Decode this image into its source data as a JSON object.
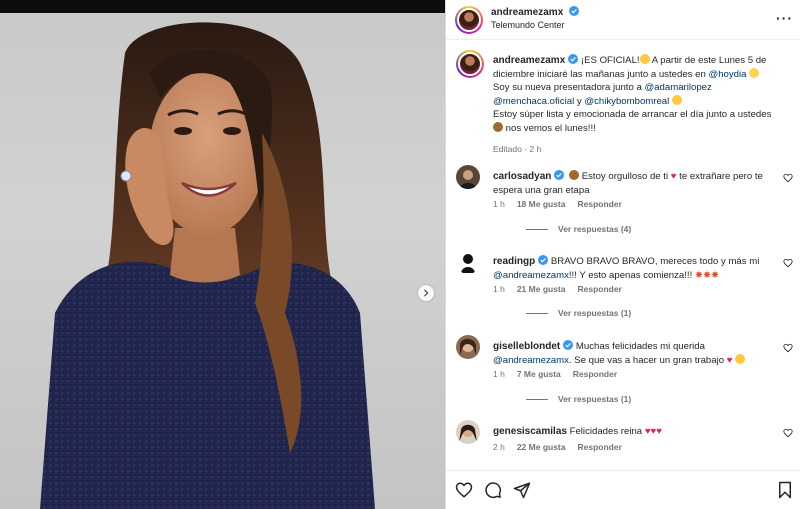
{
  "post": {
    "username": "andreamezamx",
    "location": "Telemundo Center",
    "caption": {
      "username": "andreamezamx",
      "line1_pre": "¡ES OFICIAL!",
      "line1_post": " A partir de este Lunes 5 de diciembre iniciaré las mañanas junto a ustedes en ",
      "hashtag": "@hoydia",
      "line2_pre": "Soy su nueva presentadora junto a ",
      "mention1": "@adamarilopez",
      "mention2": "@menchaca.oficial",
      "and": " y ",
      "mention3": "@chikybombomreal",
      "line3": "Estoy súper lista y emocionada de arrancar el día junto a ustedes",
      "line3_end": " nos vemos el lunes!!!",
      "meta": "Editado · 2 h"
    }
  },
  "comments": [
    {
      "username": "carlosadyan",
      "text_pre": " Estoy orgulloso de ti ",
      "text_post": " te extrañare pero te espera una gran etapa",
      "time": "1 h",
      "likes": "18 Me gusta",
      "reply": "Responder",
      "replies": "Ver respuestas (4)"
    },
    {
      "username": "readingp",
      "text_pre": "BRAVO BRAVO BRAVO, mereces todo y más mi ",
      "mention": "@andreamezamx",
      "text_post": "!!! Y esto apenas comienza!!! ",
      "time": "1 h",
      "likes": "21 Me gusta",
      "reply": "Responder",
      "replies": "Ver respuestas (1)"
    },
    {
      "username": "giselleblondet",
      "text_pre": "Muchas felicidades mi querida ",
      "mention": "@andreamezamx",
      "text_post": ". Se que vas a hacer un gran trabajo ",
      "time": "1 h",
      "likes": "7 Me gusta",
      "reply": "Responder",
      "replies": "Ver respuestas (1)"
    },
    {
      "username": "genesiscamilas",
      "text_pre": "Felicidades reina ",
      "time": "2 h",
      "likes": "22 Me gusta",
      "reply": "Responder"
    }
  ],
  "icons": {
    "more": "more-options-icon",
    "like": "heart-icon",
    "comment": "comment-icon",
    "share": "share-icon",
    "save": "bookmark-icon",
    "next": "chevron-right-icon"
  },
  "colors": {
    "link": "#00376b",
    "verified": "#3897f0",
    "heart": "#ed4956"
  }
}
